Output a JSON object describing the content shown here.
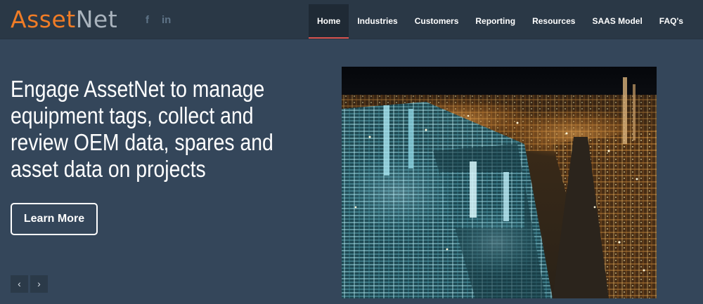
{
  "brand": {
    "logo_part1": "Asset",
    "logo_part2": "Net"
  },
  "social": {
    "facebook": "f",
    "linkedin": "in"
  },
  "nav": {
    "items": [
      {
        "label": "Home",
        "active": true
      },
      {
        "label": "Industries"
      },
      {
        "label": "Customers"
      },
      {
        "label": "Reporting"
      },
      {
        "label": "Resources"
      },
      {
        "label": "SAAS Model"
      },
      {
        "label": "FAQ's"
      }
    ]
  },
  "hero": {
    "headline": "Engage AssetNet to manage equipment tags, collect and review OEM data, spares and asset data on projects",
    "cta_label": "Learn More",
    "prev_arrow": "‹",
    "next_arrow": "›"
  },
  "colors": {
    "background": "#34465a",
    "navbar": "#2a3846",
    "logo_orange": "#f07c26",
    "logo_grey": "#a9b3bd",
    "active_underline": "#d9534f"
  }
}
